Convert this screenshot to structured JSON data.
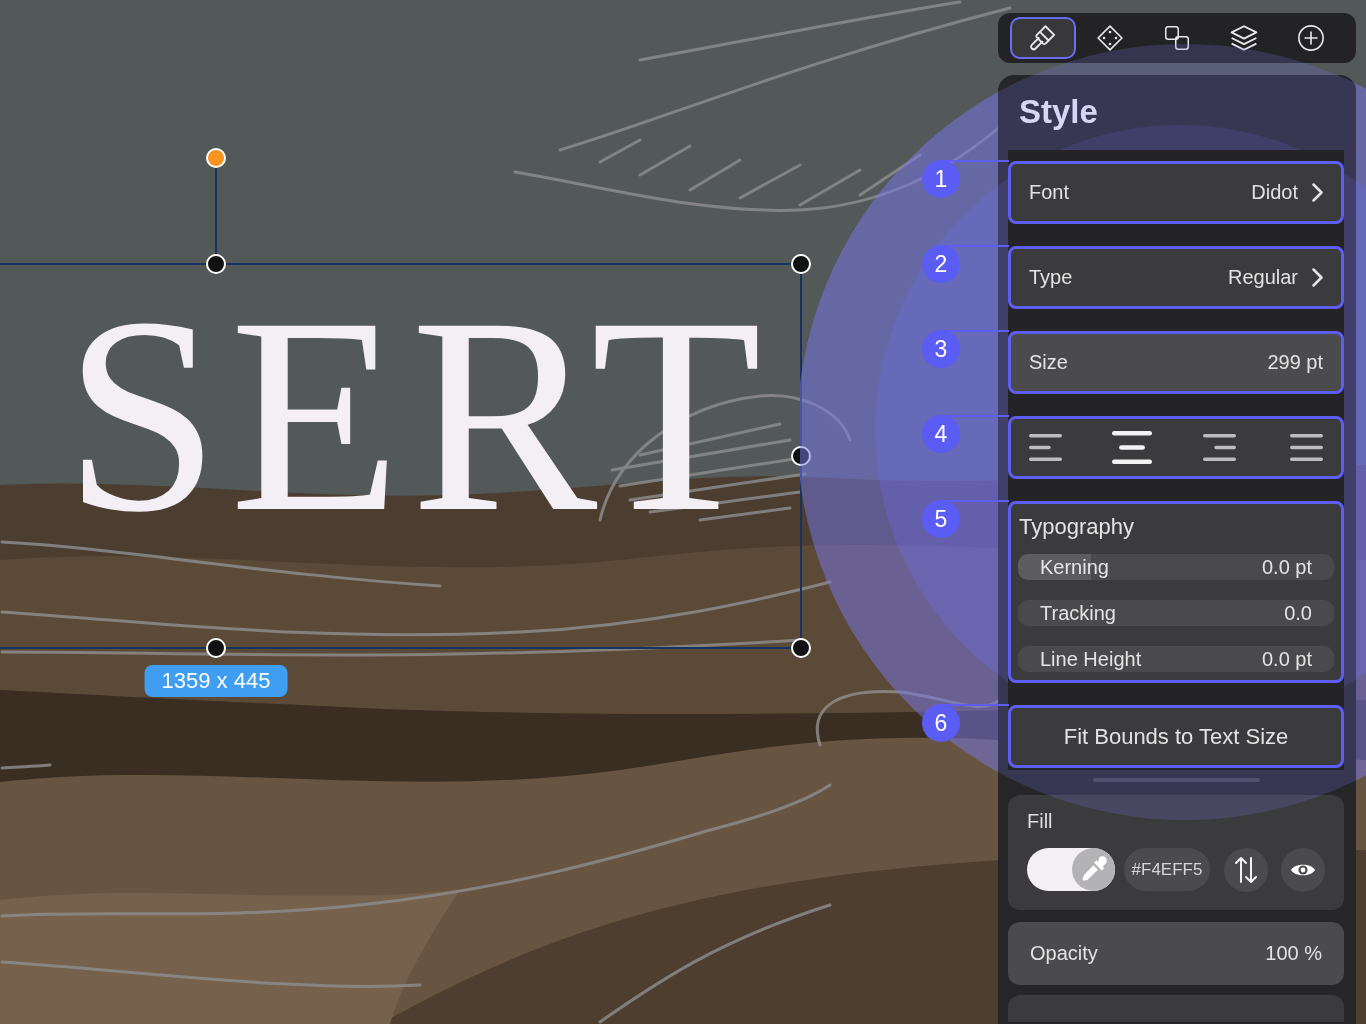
{
  "toolbar": {
    "tabs": [
      {
        "kind": "brush",
        "selected": true
      },
      {
        "kind": "diamond",
        "selected": false
      },
      {
        "kind": "squares",
        "selected": false
      },
      {
        "kind": "layers",
        "selected": false
      },
      {
        "kind": "plus",
        "selected": false
      }
    ]
  },
  "canvas": {
    "text": "SERT",
    "size_label": "1359 x 445"
  },
  "panel": {
    "title": "Style",
    "sections": [
      {
        "kind": "picker",
        "callout": "1",
        "label": "Font",
        "value": "Didot"
      },
      {
        "kind": "picker",
        "callout": "2",
        "label": "Type",
        "value": "Regular"
      },
      {
        "kind": "field",
        "callout": "3",
        "label": "Size",
        "value": "299 pt"
      },
      {
        "kind": "alignment",
        "callout": "4",
        "options": [
          {
            "kind": "left",
            "selected": false
          },
          {
            "kind": "center",
            "selected": true
          },
          {
            "kind": "right",
            "selected": false
          },
          {
            "kind": "justify",
            "selected": false
          }
        ]
      },
      {
        "kind": "group",
        "callout": "5",
        "title": "Typography",
        "sliders": [
          {
            "label": "Kerning",
            "value": "0.0 pt",
            "level": 0.23
          },
          {
            "label": "Tracking",
            "value": "0.0"
          },
          {
            "label": "Line Height",
            "value": "0.0 pt"
          }
        ]
      },
      {
        "kind": "button",
        "callout": "6",
        "label": "Fit Bounds to Text Size"
      }
    ],
    "fill": {
      "label": "Fill",
      "hex": "#F4EFF5"
    },
    "opacity": {
      "label": "Opacity",
      "value": "100 %"
    }
  }
}
